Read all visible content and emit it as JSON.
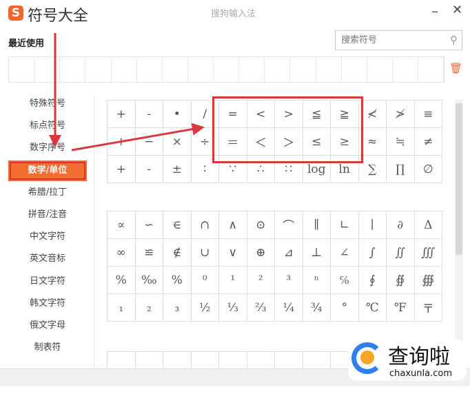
{
  "window": {
    "logo": "S",
    "title": "符号大全",
    "subtitle": "搜狗输入法",
    "minimize": "–",
    "close": "✕"
  },
  "recent": {
    "label": "最近使用",
    "trash_icon": "🗑"
  },
  "search": {
    "placeholder": "搜索符号",
    "icon": "⚲"
  },
  "sidebar": {
    "active_index": 3,
    "items": [
      "特殊符号",
      "标点符号",
      "数字序号",
      "数学/单位",
      "希腊/拉丁",
      "拼音/注音",
      "中文字符",
      "英文音标",
      "日文字符",
      "韩文字符",
      "俄文字母",
      "制表符"
    ]
  },
  "grid1": [
    "+",
    "-",
    "•",
    "/",
    "=",
    "<",
    ">",
    "≦",
    "≧",
    "≮",
    "≯",
    "≡",
    "+",
    "−",
    "×",
    "÷",
    "＝",
    "＜",
    "＞",
    "≤",
    "≥",
    "≈",
    "≒",
    "≠",
    "+",
    "-",
    "±",
    "∶",
    "∵",
    "∴",
    "∷",
    "log",
    "ln",
    "∑",
    "∏",
    "∅"
  ],
  "grid2": [
    "∝",
    "∽",
    "∈",
    "∩",
    "∧",
    "⊙",
    "⌒",
    "∥",
    "∟",
    "∣",
    "∂",
    "Δ",
    "∞",
    "≌",
    "∉",
    "∪",
    "∨",
    "⊕",
    "⊿",
    "⊥",
    "∠",
    "∫",
    "∬",
    "∭",
    "%",
    "‰",
    "%",
    "⁰",
    "¹",
    "²",
    "³",
    "ⁿ",
    "℅",
    "∮",
    "∯",
    "∰",
    "₁",
    "₂",
    "₃",
    "½",
    "⅓",
    "⅔",
    "¼",
    "¾",
    "°",
    "℃",
    "℉",
    "〒"
  ],
  "watermark": {
    "text": "查询啦",
    "url": "chaxunla.com"
  },
  "colors": {
    "accent": "#f36c30",
    "annotation": "#d9363e"
  }
}
